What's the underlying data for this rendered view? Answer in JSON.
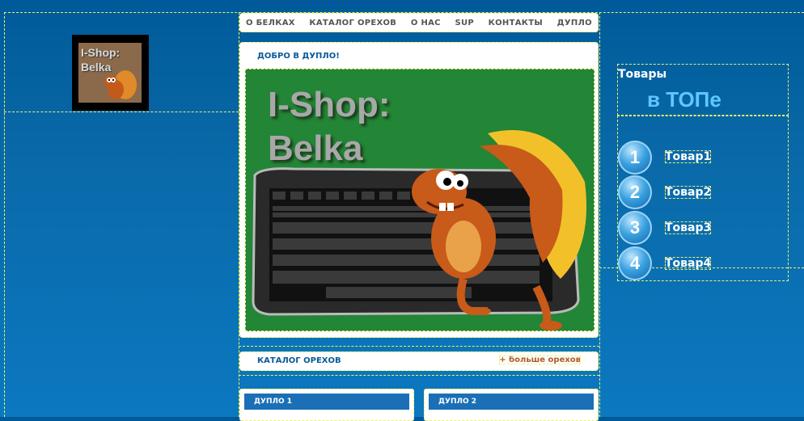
{
  "logo": {
    "line1": "I-Shop:",
    "line2": "Belka"
  },
  "nav": [
    "О БЕЛКАХ",
    "КАТАЛОГ ОРЕХОВ",
    "О НАС",
    "SUP",
    "КОНТАКТЫ",
    "ДУПЛО"
  ],
  "welcome": {
    "heading": "ДОБРО В ДУПЛО!",
    "banner_line1": "I-Shop:",
    "banner_line2": "Belka"
  },
  "catalog": {
    "title": "КАТАЛОГ ОРЕХОВ",
    "more_link": "+ больше орехов"
  },
  "dupla": [
    "ДУПЛО 1",
    "ДУПЛО 2"
  ],
  "top": {
    "title_line1": "Товары",
    "title_line2": "в ТОПе",
    "items": [
      {
        "num": "1",
        "name": "Товар1"
      },
      {
        "num": "2",
        "name": "Товар2"
      },
      {
        "num": "3",
        "name": "Товар3"
      },
      {
        "num": "4",
        "name": "Товар4"
      }
    ]
  }
}
